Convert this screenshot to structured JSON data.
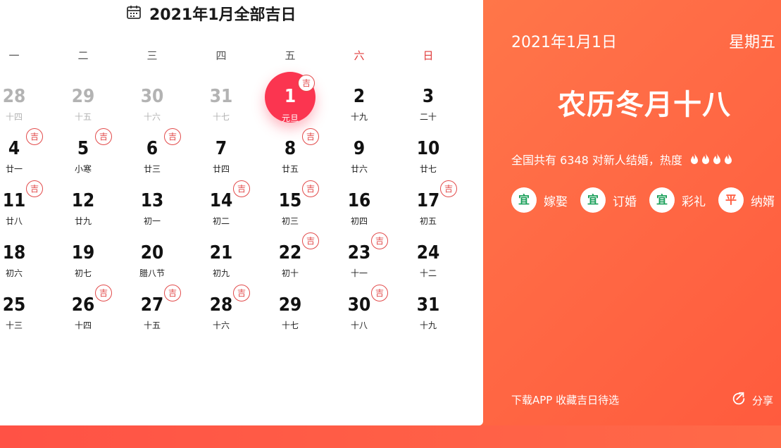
{
  "calendar": {
    "title": "2021年1月全部吉日",
    "weekdays": [
      "一",
      "二",
      "三",
      "四",
      "五",
      "六",
      "日"
    ],
    "badge_label": "吉",
    "weeks": [
      [
        {
          "n": "28",
          "l": "十四",
          "other": true
        },
        {
          "n": "29",
          "l": "十五",
          "other": true
        },
        {
          "n": "30",
          "l": "十六",
          "other": true
        },
        {
          "n": "31",
          "l": "十七",
          "other": true
        },
        {
          "n": "1",
          "l": "元旦",
          "ji": true,
          "selected": true
        },
        {
          "n": "2",
          "l": "十九"
        },
        {
          "n": "3",
          "l": "二十"
        }
      ],
      [
        {
          "n": "4",
          "l": "廿一",
          "ji": true
        },
        {
          "n": "5",
          "l": "小寒",
          "ji": true
        },
        {
          "n": "6",
          "l": "廿三",
          "ji": true
        },
        {
          "n": "7",
          "l": "廿四"
        },
        {
          "n": "8",
          "l": "廿五",
          "ji": true
        },
        {
          "n": "9",
          "l": "廿六"
        },
        {
          "n": "10",
          "l": "廿七"
        }
      ],
      [
        {
          "n": "11",
          "l": "廿八",
          "ji": true
        },
        {
          "n": "12",
          "l": "廿九"
        },
        {
          "n": "13",
          "l": "初一"
        },
        {
          "n": "14",
          "l": "初二",
          "ji": true
        },
        {
          "n": "15",
          "l": "初三",
          "ji": true
        },
        {
          "n": "16",
          "l": "初四"
        },
        {
          "n": "17",
          "l": "初五",
          "ji": true
        }
      ],
      [
        {
          "n": "18",
          "l": "初六"
        },
        {
          "n": "19",
          "l": "初七"
        },
        {
          "n": "20",
          "l": "腊八节"
        },
        {
          "n": "21",
          "l": "初九"
        },
        {
          "n": "22",
          "l": "初十",
          "ji": true
        },
        {
          "n": "23",
          "l": "十一",
          "ji": true
        },
        {
          "n": "24",
          "l": "十二"
        }
      ],
      [
        {
          "n": "25",
          "l": "十三"
        },
        {
          "n": "26",
          "l": "十四",
          "ji": true
        },
        {
          "n": "27",
          "l": "十五",
          "ji": true
        },
        {
          "n": "28",
          "l": "十六",
          "ji": true
        },
        {
          "n": "29",
          "l": "十七"
        },
        {
          "n": "30",
          "l": "十八",
          "ji": true
        },
        {
          "n": "31",
          "l": "十九"
        }
      ]
    ]
  },
  "info": {
    "date": "2021年1月1日",
    "weekday": "星期五",
    "lunar": "农历冬月十八",
    "couples_text": "全国共有 6348 对新人结婚，热度",
    "heat_level": 4,
    "items": [
      {
        "tag": "宜",
        "label": "嫁娶",
        "type": "good"
      },
      {
        "tag": "宜",
        "label": "订婚",
        "type": "good"
      },
      {
        "tag": "宜",
        "label": "彩礼",
        "type": "good"
      },
      {
        "tag": "平",
        "label": "纳婿",
        "type": "neutral"
      }
    ],
    "footer_link": "下载APP 收藏吉日待选",
    "share_label": "分享"
  },
  "colors": {
    "accent_red": "#fb3550",
    "badge_red": "#e24a4a",
    "good_green": "#1aa05a",
    "orange": "#ff6e47"
  }
}
